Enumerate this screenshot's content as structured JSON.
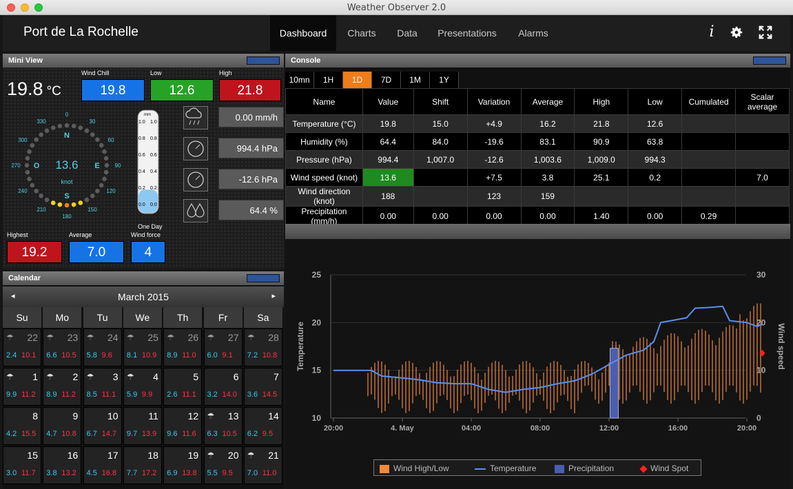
{
  "window": {
    "title": "Weather Observer 2.0"
  },
  "station": "Port de La Rochelle",
  "nav": {
    "tabs": [
      "Dashboard",
      "Charts",
      "Data",
      "Presentations",
      "Alarms"
    ],
    "active": "Dashboard",
    "icons": [
      "info-icon",
      "gear-icon",
      "fullscreen-icon"
    ]
  },
  "mini_view": {
    "title": "Mini View",
    "temperature": "19.8",
    "temp_unit": "°C",
    "wind_chill_label": "Wind Chill",
    "wind_chill": "19.8",
    "low_label": "Low",
    "low": "12.6",
    "high_label": "High",
    "high": "21.8",
    "compass": {
      "speed": "13.6",
      "unit": "knot",
      "N": "N",
      "E": "E",
      "S": "S",
      "O": "O",
      "degrees": [
        "0",
        "30",
        "60",
        "90",
        "120",
        "150",
        "180",
        "210",
        "240",
        "270",
        "300",
        "330"
      ]
    },
    "gauge_label": "One Day",
    "gauge_unit": "mm",
    "gauge_ticks": [
      "1.0",
      "0.8",
      "0.6",
      "0.4",
      "0.2",
      "0.0"
    ],
    "gauge_ticks_right": [
      "1.0",
      "0.8",
      "0.6",
      "0.4",
      "0.2",
      "0.0"
    ],
    "gauge_level": 0.17,
    "rain_rate": "0.00 mm/h",
    "pressure": "994.4 hPa",
    "pressure_var": "-12.6 hPa",
    "humidity": "64.4 %",
    "highest_label": "Highest",
    "highest": "19.2",
    "average_label": "Average",
    "average": "7.0",
    "wind_force_label": "Wind force",
    "wind_force": "4"
  },
  "calendar": {
    "title": "Calendar",
    "month": "March 2015",
    "prev": "◂",
    "next": "▸",
    "weekdays": [
      "Su",
      "Mo",
      "Tu",
      "We",
      "Th",
      "Fr",
      "Sa"
    ],
    "weeks": [
      [
        {
          "d": "22",
          "lo": "2.4",
          "hi": "10.1",
          "icon": "☂",
          "past": true
        },
        {
          "d": "23",
          "lo": "6.6",
          "hi": "10.5",
          "icon": "☂",
          "past": true
        },
        {
          "d": "24",
          "lo": "5.8",
          "hi": "9.6",
          "icon": "☂",
          "past": true
        },
        {
          "d": "25",
          "lo": "8.1",
          "hi": "10.9",
          "icon": "☂",
          "past": true
        },
        {
          "d": "26",
          "lo": "8.9",
          "hi": "11.0",
          "icon": "☂",
          "past": true
        },
        {
          "d": "27",
          "lo": "6.0",
          "hi": "9.1",
          "icon": "☂",
          "past": true
        },
        {
          "d": "28",
          "lo": "7.2",
          "hi": "10.8",
          "icon": "☂",
          "past": true
        }
      ],
      [
        {
          "d": "1",
          "lo": "9.9",
          "hi": "11.2",
          "icon": "☂"
        },
        {
          "d": "2",
          "lo": "8.9",
          "hi": "11.2",
          "icon": "☂"
        },
        {
          "d": "3",
          "lo": "8.5",
          "hi": "11.1",
          "icon": "☂"
        },
        {
          "d": "4",
          "lo": "5.9",
          "hi": "9.9",
          "icon": "☂"
        },
        {
          "d": "5",
          "lo": "2.6",
          "hi": "11.1",
          "icon": ""
        },
        {
          "d": "6",
          "lo": "3.2",
          "hi": "14.0",
          "icon": ""
        },
        {
          "d": "7",
          "lo": "3.6",
          "hi": "14.5",
          "icon": ""
        }
      ],
      [
        {
          "d": "8",
          "lo": "4.2",
          "hi": "15.5",
          "icon": ""
        },
        {
          "d": "9",
          "lo": "4.7",
          "hi": "10.8",
          "icon": ""
        },
        {
          "d": "10",
          "lo": "6.7",
          "hi": "14.7",
          "icon": ""
        },
        {
          "d": "11",
          "lo": "9.7",
          "hi": "13.9",
          "icon": ""
        },
        {
          "d": "12",
          "lo": "9.6",
          "hi": "11.6",
          "icon": ""
        },
        {
          "d": "13",
          "lo": "6.3",
          "hi": "10.5",
          "icon": "☂"
        },
        {
          "d": "14",
          "lo": "6.2",
          "hi": "9.5",
          "icon": ""
        }
      ],
      [
        {
          "d": "15",
          "lo": "3.0",
          "hi": "11.7",
          "icon": ""
        },
        {
          "d": "16",
          "lo": "3.8",
          "hi": "13.2",
          "icon": ""
        },
        {
          "d": "17",
          "lo": "4.5",
          "hi": "16.8",
          "icon": ""
        },
        {
          "d": "18",
          "lo": "7.7",
          "hi": "17.2",
          "icon": ""
        },
        {
          "d": "19",
          "lo": "6.9",
          "hi": "13.8",
          "icon": ""
        },
        {
          "d": "20",
          "lo": "5.5",
          "hi": "9.5",
          "icon": "☂"
        },
        {
          "d": "21",
          "lo": "7.0",
          "hi": "11.0",
          "icon": "☂"
        }
      ]
    ]
  },
  "console": {
    "title": "Console",
    "ranges": [
      "10mn",
      "1H",
      "1D",
      "7D",
      "1M",
      "1Y"
    ],
    "active_range": "1D",
    "headers": [
      "Name",
      "Value",
      "Shift",
      "Variation",
      "Average",
      "High",
      "Low",
      "Cumulated",
      "Scalar average"
    ],
    "rows": [
      [
        "Temperature (°C)",
        "19.8",
        "15.0",
        "+4.9",
        "16.2",
        "21.8",
        "12.6",
        "",
        ""
      ],
      [
        "Humidity (%)",
        "64.4",
        "84.0",
        "-19.6",
        "83.1",
        "90.9",
        "63.8",
        "",
        ""
      ],
      [
        "Pressure (hPa)",
        "994.4",
        "1,007.0",
        "-12.6",
        "1,003.6",
        "1,009.0",
        "994.3",
        "",
        ""
      ],
      [
        "Wind speed (knot)",
        "13.6",
        "",
        "+7.5",
        "3.8",
        "25.1",
        "0.2",
        "",
        "7.0"
      ],
      [
        "Wind direction (knot)",
        "188",
        "",
        "123",
        "159",
        "",
        "",
        "",
        ""
      ],
      [
        "Precipitation (mm/h)",
        "0.00",
        "0.00",
        "0.00",
        "0.00",
        "1.40",
        "0.00",
        "0.29",
        ""
      ]
    ]
  },
  "chart_data": {
    "type": "line",
    "ylabel": "Temperature",
    "y2label": "Wind speed",
    "ylim": [
      10,
      25
    ],
    "yticks": [
      "25",
      "20",
      "15",
      "10"
    ],
    "y2lim": [
      0,
      30
    ],
    "y2ticks": [
      "30",
      "20",
      "10",
      "0"
    ],
    "xticks": [
      "20:00",
      "4. May",
      "04:00",
      "08:00",
      "12:00",
      "16:00",
      "20:00"
    ],
    "xrange_hours": [
      0,
      24
    ],
    "grid": true,
    "legend": [
      "Wind High/Low",
      "Temperature",
      "Precipitation",
      "Wind Spot"
    ],
    "legend_position": "bottom",
    "colors": {
      "wind": "#f08a3c",
      "temperature": "#5b8ff0",
      "precip": "#4a5db0",
      "spot": "#ff2020"
    },
    "temperature": [
      [
        0,
        15.0
      ],
      [
        2.2,
        15.0
      ],
      [
        2.8,
        14.4
      ],
      [
        4,
        14.2
      ],
      [
        5,
        14.0
      ],
      [
        6,
        13.7
      ],
      [
        7,
        13.6
      ],
      [
        8,
        13.6
      ],
      [
        9,
        13.0
      ],
      [
        10,
        12.7
      ],
      [
        11,
        13.0
      ],
      [
        12,
        13.2
      ],
      [
        13,
        13.6
      ],
      [
        14,
        13.9
      ],
      [
        15,
        14.6
      ],
      [
        16,
        15.6
      ],
      [
        17,
        16.6
      ],
      [
        18,
        17.1
      ],
      [
        18.6,
        18.0
      ],
      [
        19,
        20.0
      ],
      [
        19.6,
        20.2
      ],
      [
        20.5,
        20.5
      ],
      [
        21,
        21.5
      ],
      [
        22,
        21.6
      ],
      [
        22.6,
        21.7
      ],
      [
        23,
        20.2
      ],
      [
        24,
        20.0
      ],
      [
        24.6,
        19.6
      ],
      [
        24.9,
        19.8
      ]
    ],
    "wind_range": {
      "from_hour": 2.0,
      "to_hour": 24.8
    },
    "precipitation": [
      {
        "hour": 16.3,
        "value": 1.4
      }
    ],
    "wind_spot": {
      "hour": 24.9,
      "value": 13.6
    }
  }
}
